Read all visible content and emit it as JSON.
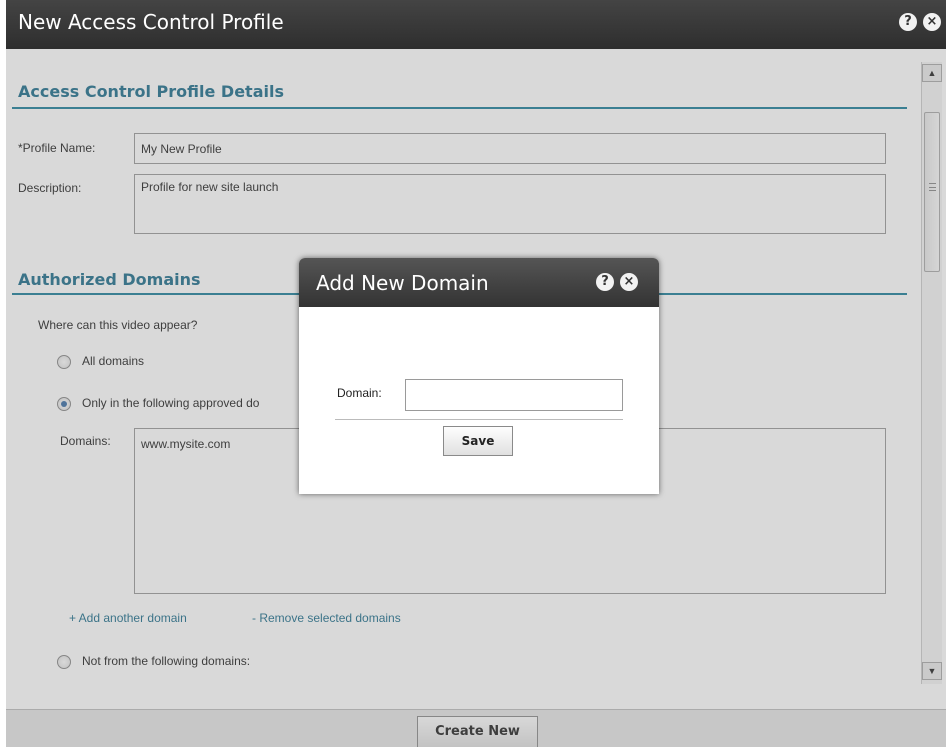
{
  "window": {
    "title": "New Access Control Profile",
    "help_icon": "?",
    "close_icon": "×"
  },
  "details": {
    "heading": "Access Control Profile Details",
    "profile_name_label": "*Profile Name:",
    "profile_name_value": "My New Profile",
    "description_label": "Description:",
    "description_value": "Profile for new site launch"
  },
  "domains": {
    "heading": "Authorized Domains",
    "question": "Where can this video appear?",
    "options": [
      {
        "label": "All domains",
        "checked": false
      },
      {
        "label": "Only in the following approved do",
        "checked": true
      },
      {
        "label": "Not from the following domains:",
        "checked": false
      }
    ],
    "domains_label": "Domains:",
    "domain_list": [
      "www.mysite.com"
    ],
    "add_link": "+ Add another domain",
    "remove_link": "- Remove selected domains"
  },
  "footer": {
    "create_button": "Create New"
  },
  "dialog": {
    "title": "Add New Domain",
    "help_icon": "?",
    "close_icon": "×",
    "domain_label": "Domain:",
    "domain_value": "",
    "save_button": "Save"
  }
}
